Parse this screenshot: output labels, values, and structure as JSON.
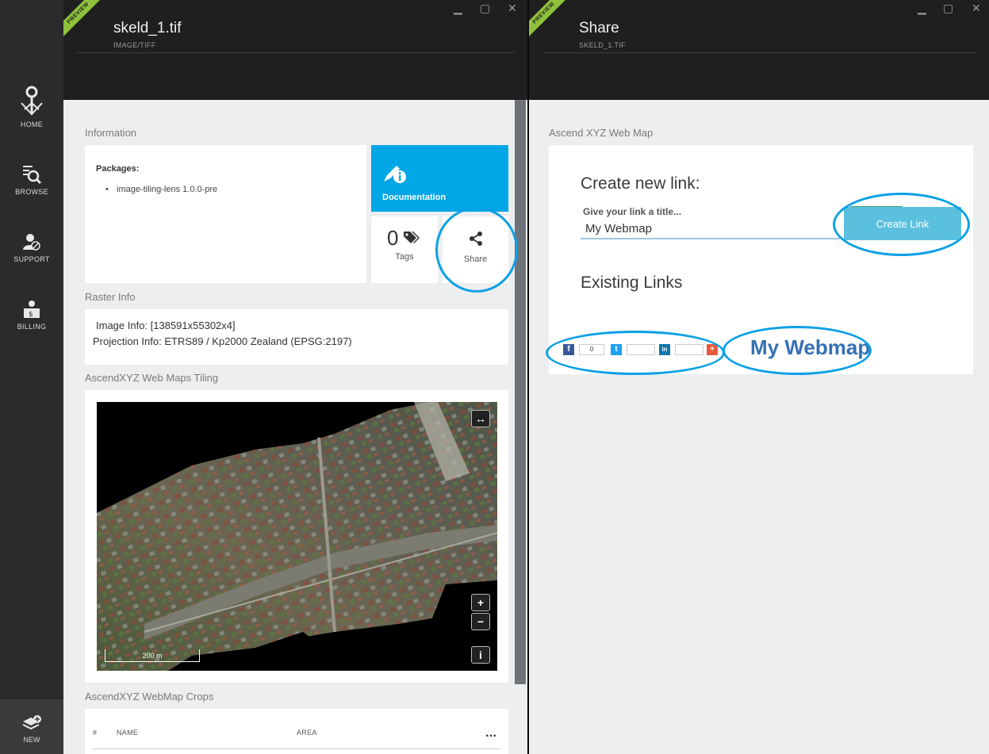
{
  "nav": {
    "items": [
      {
        "label": "HOME"
      },
      {
        "label": "BROWSE"
      },
      {
        "label": "SUPPORT"
      },
      {
        "label": "BILLING"
      }
    ],
    "new_label": "NEW"
  },
  "left_blade": {
    "ribbon": "PREVIEW",
    "title": "skeld_1.tif",
    "subtitle": "IMAGE/TIFF",
    "information_label": "Information",
    "packages_title": "Packages:",
    "packages": [
      "image-tiling-lens 1.0.0-pre"
    ],
    "documentation_label": "Documentation",
    "tags_count": "0",
    "tags_label": "Tags",
    "share_label": "Share",
    "raster_info_label": "Raster Info",
    "image_info": "Image Info: [138591x55302x4]",
    "projection_info": "Projection Info: ETRS89 / Kp2000 Zealand (EPSG:2197)",
    "tiling_label": "AscendXYZ Web Maps Tiling",
    "map": {
      "scale_label": "200 m",
      "zoom_in": "+",
      "zoom_out": "−",
      "info": "i",
      "expand": "↔"
    },
    "crops_label": "AscendXYZ WebMap Crops",
    "crops_table": {
      "columns": [
        "#",
        "NAME",
        "AREA"
      ],
      "more": "..."
    }
  },
  "right_blade": {
    "ribbon": "PREVIEW",
    "title": "Share",
    "subtitle": "SKELD_1.TIF",
    "section_label": "Ascend XYZ Web Map",
    "create_title": "Create new link:",
    "input_label": "Give your link a title...",
    "input_value": "My Webmap",
    "create_button": "Create Link",
    "existing_title": "Existing Links",
    "social": {
      "facebook": "f",
      "facebook_count": "0",
      "twitter": "t",
      "linkedin": "in",
      "plus": "+"
    },
    "link_text": "My Webmap"
  },
  "colors": {
    "accent": "#00a6e6",
    "highlight": "#0aa0e6",
    "link": "#3571b5",
    "button": "#5bc0de",
    "preview_ribbon": "#8fc23c"
  }
}
